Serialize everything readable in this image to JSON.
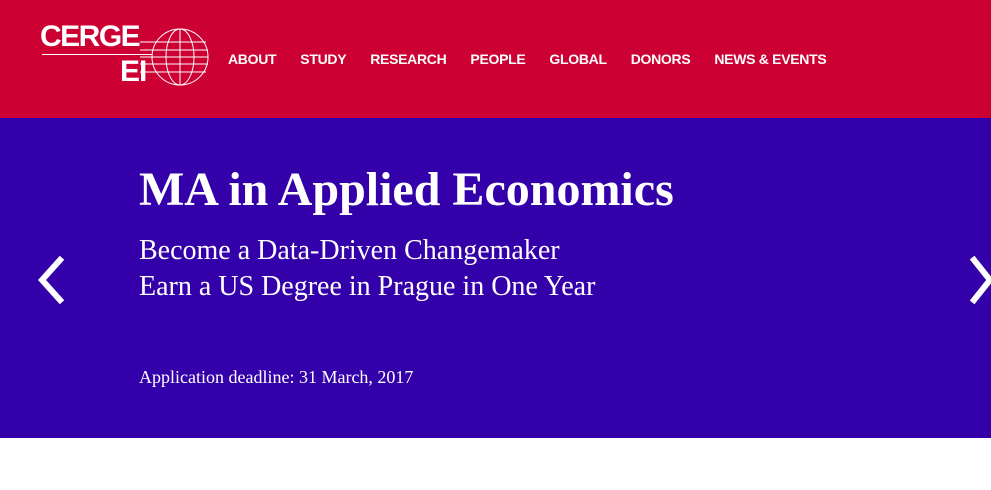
{
  "header": {
    "logo": {
      "line1": "CERGE",
      "line2": "EI"
    },
    "nav": [
      {
        "label": "ABOUT"
      },
      {
        "label": "STUDY"
      },
      {
        "label": "RESEARCH"
      },
      {
        "label": "PEOPLE"
      },
      {
        "label": "GLOBAL"
      },
      {
        "label": "DONORS"
      },
      {
        "label": "NEWS & EVENTS"
      }
    ]
  },
  "hero": {
    "title": "MA in Applied Economics",
    "subtitle_line1": "Become a Data-Driven Changemaker",
    "subtitle_line2": "Earn a US Degree in Prague in One Year",
    "deadline": "Application deadline: 31 March, 2017"
  },
  "colors": {
    "header_bg": "#cc0033",
    "hero_bg": "#3300aa",
    "text": "#ffffff"
  },
  "icons": {
    "prev": "chevron-left-icon",
    "next": "chevron-right-icon",
    "globe": "globe-icon"
  }
}
